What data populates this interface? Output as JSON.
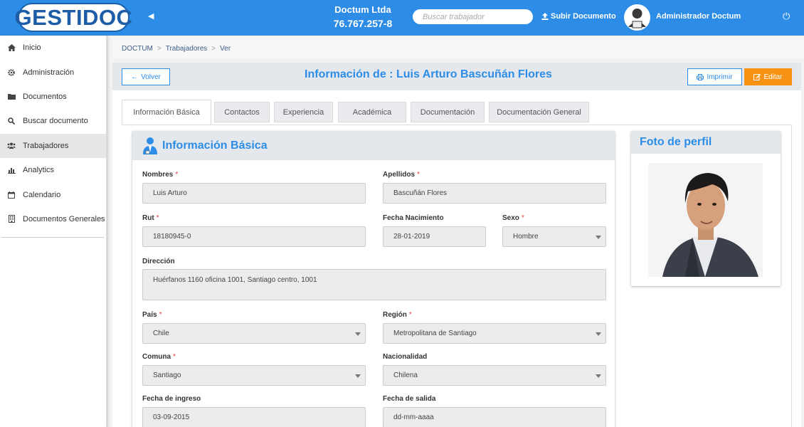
{
  "brand": {
    "logo": "GESTIDOC"
  },
  "header": {
    "company_name": "Doctum Ltda",
    "company_rut": "76.767.257-8",
    "search_placeholder": "Buscar trabajador",
    "upload_label": "Subir Documento",
    "user_name": "Administrador Doctum"
  },
  "sidebar": {
    "items": [
      {
        "label": "Inicio",
        "icon": "home-icon"
      },
      {
        "label": "Administración",
        "icon": "gear-icon"
      },
      {
        "label": "Documentos",
        "icon": "folder-icon"
      },
      {
        "label": "Buscar documento",
        "icon": "search-icon"
      },
      {
        "label": "Trabajadores",
        "icon": "users-icon",
        "active": true
      },
      {
        "label": "Analytics",
        "icon": "bar-chart-icon"
      },
      {
        "label": "Calendario",
        "icon": "calendar-icon"
      },
      {
        "label": "Documentos Generales",
        "icon": "building-icon"
      }
    ]
  },
  "breadcrumb": [
    "DOCTUM",
    "Trabajadores",
    "Ver"
  ],
  "page": {
    "title": "Información de : Luis Arturo Bascuñán Flores",
    "back_label": "Volver",
    "print_label": "Imprimir",
    "edit_label": "Editar",
    "accent": "#2d8de6",
    "edit_color": "#f69314"
  },
  "tabs": [
    "Información Básica",
    "Contactos",
    "Experiencia",
    "Académica",
    "Documentación",
    "Documentación General"
  ],
  "basic_info": {
    "heading": "Información Básica",
    "nombres_label": "Nombres",
    "nombres": "Luis Arturo",
    "apellidos_label": "Apellidos",
    "apellidos": "Bascuñán Flores",
    "rut_label": "Rut",
    "rut": "18180945-0",
    "fecha_nac_label": "Fecha Nacimiento",
    "fecha_nac": "28-01-2019",
    "sexo_label": "Sexo",
    "sexo": "Hombre",
    "direccion_label": "Dirección",
    "direccion": "Huérfanos 1160 oficina 1001, Santiago centro, 1001",
    "pais_label": "País",
    "pais": "Chile",
    "region_label": "Región",
    "region": "Metropolitana de Santiago",
    "comuna_label": "Comuna",
    "comuna": "Santiago",
    "nacionalidad_label": "Nacionalidad",
    "nacionalidad": "Chilena",
    "fecha_ingreso_label": "Fecha de ingreso",
    "fecha_ingreso": "03-09-2015",
    "fecha_salida_label": "Fecha de salida",
    "fecha_salida_placeholder": "dd-mm-aaaa",
    "required_mark": "*"
  },
  "profile_photo": {
    "heading": "Foto de perfil"
  }
}
